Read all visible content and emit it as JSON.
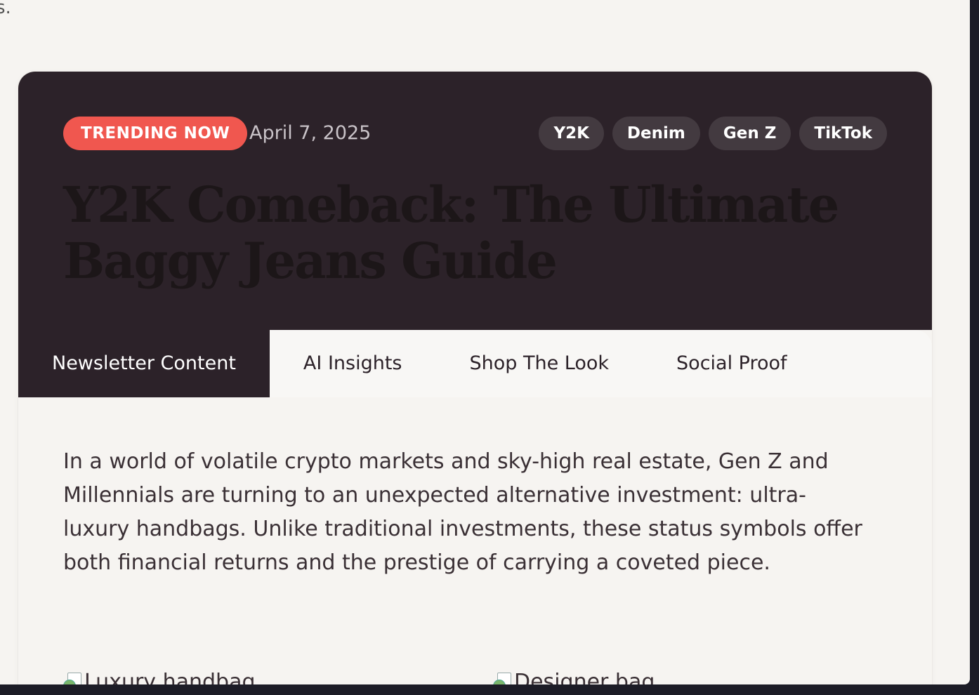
{
  "page": {
    "corner_text": "s."
  },
  "hero": {
    "badge": "TRENDING NOW",
    "date": "April 7, 2025",
    "tags": [
      "Y2K",
      "Denim",
      "Gen Z",
      "TikTok"
    ],
    "title": "Y2K Comeback: The Ultimate Baggy Jeans Guide"
  },
  "tabs": [
    {
      "label": "Newsletter Content",
      "active": true
    },
    {
      "label": "AI Insights",
      "active": false
    },
    {
      "label": "Shop The Look",
      "active": false
    },
    {
      "label": "Social Proof",
      "active": false
    }
  ],
  "content": {
    "paragraph": "In a world of volatile crypto markets and sky-high real estate, Gen Z and Millennials are turning to an unexpected alternative investment: ultra-luxury handbags. Unlike traditional investments, these status symbols offer both financial returns and the prestige of carrying a coveted piece.",
    "images": [
      {
        "alt": "Luxury handbag"
      },
      {
        "alt": "Designer bag"
      }
    ]
  },
  "colors": {
    "hero_bg": "#2c2229",
    "badge": "#f0574f",
    "page_bg": "#f6f4f1"
  }
}
